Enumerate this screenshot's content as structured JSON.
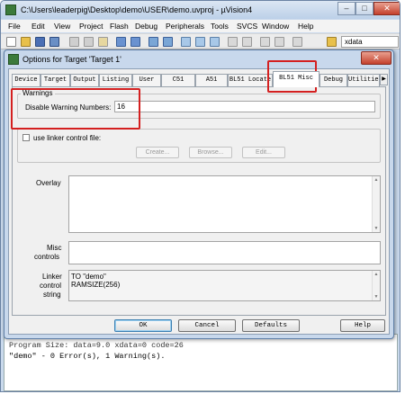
{
  "window": {
    "title": "C:\\Users\\leaderpig\\Desktop\\demo\\USER\\demo.uvproj - µVision4",
    "minimize_glyph": "–",
    "maximize_glyph": "□",
    "close_glyph": "✕"
  },
  "menu": [
    "File",
    "Edit",
    "View",
    "Project",
    "Flash",
    "Debug",
    "Peripherals",
    "Tools",
    "SVCS",
    "Window",
    "Help"
  ],
  "toolbar": {
    "target_box_value": "xdata"
  },
  "dialog": {
    "title": "Options for Target 'Target 1'",
    "close_glyph": "✕",
    "tabs": [
      "Device",
      "Target",
      "Output",
      "Listing",
      "User",
      "C51",
      "A51",
      "BL51 Locate",
      "BL51 Misc",
      "Debug",
      "Utilities"
    ],
    "active_tab": "BL51 Misc",
    "warnings": {
      "legend": "Warnings",
      "label": "Disable Warning Numbers:",
      "value": "16"
    },
    "linker_control_file": {
      "checkbox_label": "use linker control file:",
      "checked": false,
      "buttons": [
        "Create...",
        "Browse...",
        "Edit..."
      ]
    },
    "overlay_label": "Overlay",
    "misc_controls_label": [
      "Misc",
      "controls"
    ],
    "linker_control_string_label": [
      "Linker",
      "control",
      "string"
    ],
    "linker_control_string_lines": [
      "TO \"demo\"",
      "RAMSIZE(256)"
    ],
    "buttons": {
      "ok": "OK",
      "cancel": "Cancel",
      "defaults": "Defaults",
      "help": "Help"
    }
  },
  "output": {
    "line1": "Program Size: data=9.0 xdata=0 code=26",
    "line2": "\"demo\" - 0 Error(s), 1 Warning(s)."
  },
  "colors": {
    "highlight": "#d42020",
    "titlebar": "#c9d9ec"
  }
}
